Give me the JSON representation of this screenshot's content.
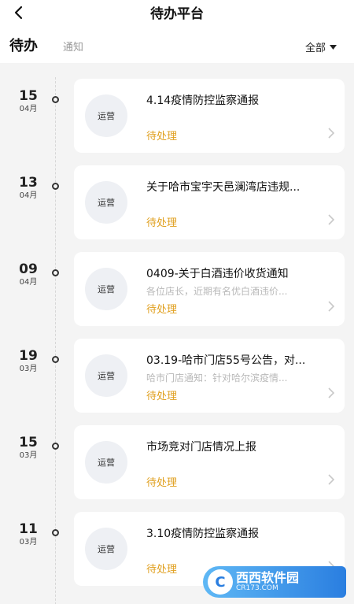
{
  "header": {
    "title": "待办平台",
    "back_icon": "chevron-left-icon"
  },
  "tabs": {
    "active": "待办",
    "inactive": "通知"
  },
  "filter": {
    "label": "全部",
    "icon": "caret-down-icon"
  },
  "items": [
    {
      "day": "15",
      "month": "04月",
      "avatar": "运营",
      "title": "4.14疫情防控监察通报",
      "preview": "",
      "status": "待处理"
    },
    {
      "day": "13",
      "month": "04月",
      "avatar": "运营",
      "title": "关于哈市宝宇天邑澜湾店违规...",
      "preview": "",
      "status": "待处理"
    },
    {
      "day": "09",
      "month": "04月",
      "avatar": "运营",
      "title": "0409-关于白酒违价收货通知",
      "preview": "各位店长，近期有名优白酒违价...",
      "status": "待处理"
    },
    {
      "day": "19",
      "month": "03月",
      "avatar": "运营",
      "title": "03.19-哈市门店55号公告，对...",
      "preview": "哈市门店通知：针对哈尔滨疫情...",
      "status": "待处理"
    },
    {
      "day": "15",
      "month": "03月",
      "avatar": "运营",
      "title": "市场竞对门店情况上报",
      "preview": "",
      "status": "待处理"
    },
    {
      "day": "11",
      "month": "03月",
      "avatar": "运营",
      "title": "3.10疫情防控监察通报",
      "preview": "",
      "status": "待处理"
    }
  ],
  "watermark": {
    "logo": "C",
    "main": "西西软件园",
    "sub": "CR173.COM"
  },
  "colors": {
    "status": "#e0a020",
    "background": "#f4f4f4",
    "card": "#ffffff"
  }
}
